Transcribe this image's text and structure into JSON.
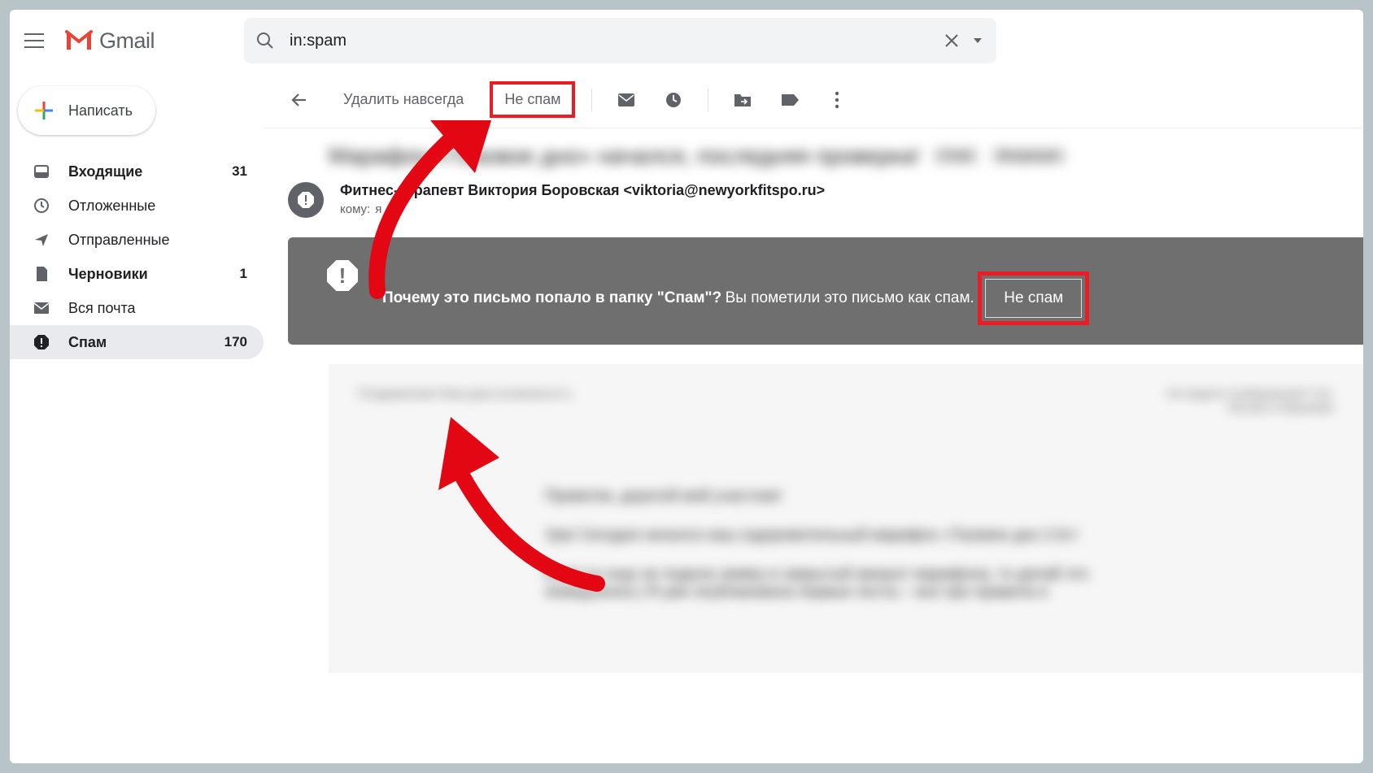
{
  "header": {
    "brand": "Gmail",
    "search_value": "in:spam"
  },
  "sidebar": {
    "compose_label": "Написать",
    "items": [
      {
        "icon": "inbox",
        "label": "Входящие",
        "count": "31",
        "bold": true,
        "active": false
      },
      {
        "icon": "clock",
        "label": "Отложенные",
        "count": "",
        "bold": false,
        "active": false
      },
      {
        "icon": "send",
        "label": "Отправленные",
        "count": "",
        "bold": false,
        "active": false
      },
      {
        "icon": "file",
        "label": "Черновики",
        "count": "1",
        "bold": true,
        "active": false
      },
      {
        "icon": "mail",
        "label": "Вся почта",
        "count": "",
        "bold": false,
        "active": false
      },
      {
        "icon": "spam",
        "label": "Спам",
        "count": "170",
        "bold": true,
        "active": true
      }
    ]
  },
  "toolbar": {
    "delete_forever": "Удалить навсегда",
    "not_spam": "Не спам"
  },
  "message": {
    "subject_blurred": "Марафон «Тазовое дно» начался, последняя проверка!",
    "labels_blurred": [
      "Спам",
      "Входящие"
    ],
    "sender": "Фитнес-терапевт Виктория Боровская <viktoria@newyorkfitspo.ru>",
    "to_prefix": "кому:",
    "to_value": "я"
  },
  "banner": {
    "title": "Почему это письмо попало в папку \"Спам\"?",
    "subtitle": "Вы пометили это письмо как спам.",
    "button": "Не спам"
  },
  "body": {
    "top_left": "Поздравляем! Вам дана возможность",
    "top_right_1": "Не видите изображения? См.",
    "top_right_2": "письмо в браузере",
    "p1": "Приветик, дорогой мой участник!",
    "p2": "Ура! Сегодня начался наш оздоровительный марафон «Тазовое дно 2.0»!",
    "p3": "Если ты еще не подала заявку в закрытый аккаунт марафона, то делай это немедленно:) Я уже опубликовала первые посты – все про правила и"
  }
}
